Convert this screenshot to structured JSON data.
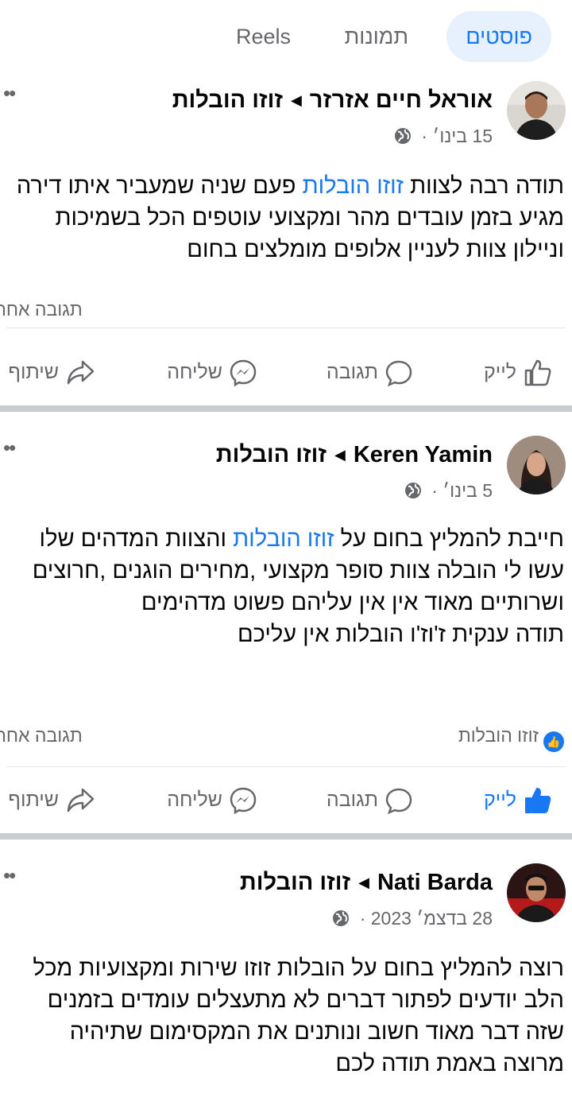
{
  "tabs": [
    {
      "label": "פוסטים",
      "active": true
    },
    {
      "label": "תמונות",
      "active": false
    },
    {
      "label": "Reels",
      "active": false
    }
  ],
  "colors": {
    "accent": "#1877f2",
    "muted": "#65676b",
    "divider": "#c9ccd1"
  },
  "posts": [
    {
      "author": "אוראל חיים אזרזר",
      "page": "זוזו הובלות",
      "date": "15 בינו׳",
      "text_before_link": "תודה רבה לצוות ",
      "link": "זוזו הובלות",
      "text_after_link": " פעם שניה שמעביר איתו דירה מגיע בזמן עובדים מהר ומקצועי עוטפים הכל בשמיכות וניילון צוות לעניין אלופים מומלצים בחום",
      "reply_label": "תגובה אחת",
      "reacted_by": "",
      "liked": false,
      "actions": {
        "like": "לייק",
        "comment": "תגובה",
        "send": "שליחה",
        "share": "שיתוף"
      }
    },
    {
      "author": "Keren Yamin",
      "page": "זוזו הובלות",
      "date": "5 בינו׳",
      "text_before_link": "חייבת להמליץ בחום על ",
      "link": "זוזו הובלות",
      "text_after_link": " והצוות המדהים שלו עשו לי הובלה צוות סופר מקצועי ,מחירים הוגנים ,חרוצים ושרותיים מאוד אין אין עליהם פשוט מדהימים\nתודה ענקית ז'וז'ו הובלות  אין עליכם",
      "reply_label": "תגובה אחת",
      "reacted_by": "זוזו הובלות",
      "liked": true,
      "actions": {
        "like": "לייק",
        "comment": "תגובה",
        "send": "שליחה",
        "share": "שיתוף"
      }
    },
    {
      "author": "Nati Barda",
      "page": "זוזו הובלות",
      "date": "28 בדצמ׳ 2023",
      "text_before_link": "רוצה להמליץ בחום על הובלות זוזו שירות ומקצועיות מכל הלב יודעים לפתור דברים לא מתעצלים עומדים בזמנים שזה דבר מאוד חשוב ונותנים את המקסימום שתיהיה מרוצה באמת תודה לכם",
      "link": "",
      "text_after_link": "",
      "reply_label": "",
      "reacted_by": "",
      "liked": false,
      "actions": {}
    }
  ],
  "icons": {
    "more": "more-dots-icon",
    "globe": "globe-icon",
    "like": "thumbs-up-icon",
    "comment": "comment-bubble-icon",
    "send": "messenger-icon",
    "share": "share-arrow-icon"
  }
}
